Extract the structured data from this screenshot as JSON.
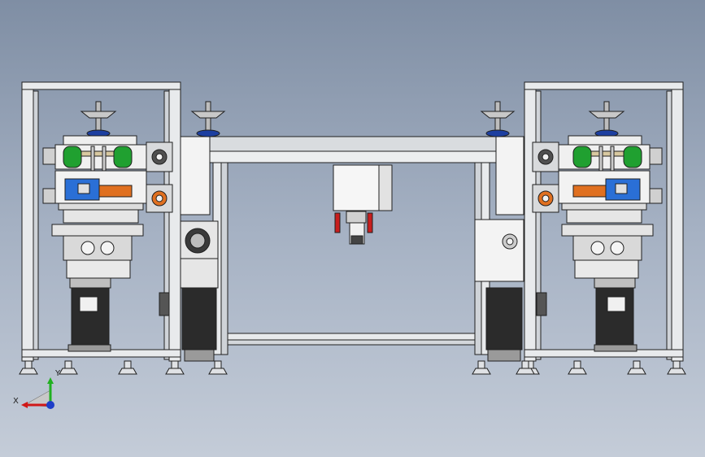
{
  "triad": {
    "x_label": "X",
    "y_label": "Y"
  },
  "colors": {
    "background_top": "#7f8ea4",
    "background_bottom": "#c4ccd8",
    "frame": "#e8eaec",
    "outline": "#202020",
    "motor": "#2b2b2b",
    "pulley": "#20a030",
    "actuator": "#2a6fd6",
    "accent": "#e07020",
    "bearing": "#1d3fa0",
    "red": "#c81e1e",
    "x_axis": "#d01818",
    "y_axis": "#20b020",
    "z_axis": "#1e3ec8"
  }
}
